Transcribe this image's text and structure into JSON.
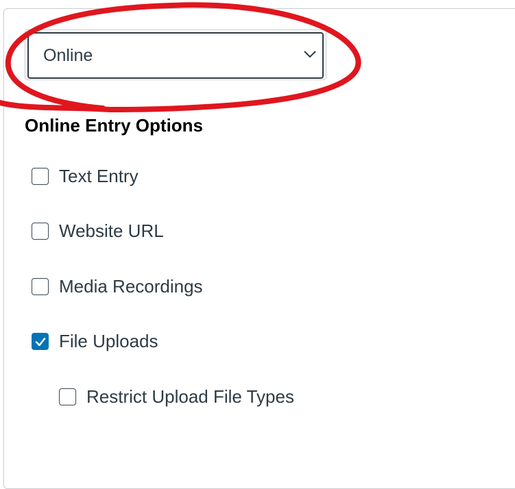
{
  "submission_type": {
    "selected": "Online"
  },
  "online_entry": {
    "title": "Online Entry Options",
    "options": [
      {
        "label": "Text Entry",
        "checked": false
      },
      {
        "label": "Website URL",
        "checked": false
      },
      {
        "label": "Media Recordings",
        "checked": false
      },
      {
        "label": "File Uploads",
        "checked": true
      },
      {
        "label": "Restrict Upload File Types",
        "checked": false
      }
    ]
  },
  "icons": {
    "dropdown": "chevron-down-icon",
    "checked": "checkmark-icon"
  },
  "colors": {
    "checkbox_checked": "#0374b5",
    "annotation_circle": "#e0161e",
    "text": "#2d3b45"
  }
}
